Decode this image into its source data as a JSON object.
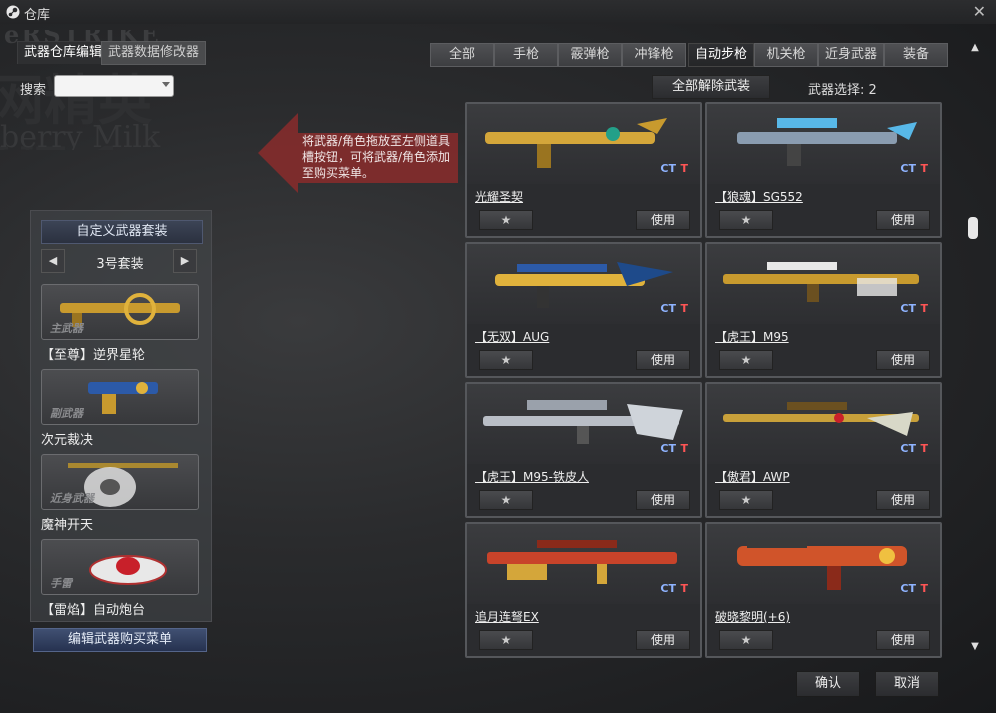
{
  "window": {
    "title": "仓库",
    "close_icon": "close-icon"
  },
  "background_logo": {
    "line1": "eRSTRIKE",
    "line2": "网精英V7.1",
    "line3": "berry Milk Edition"
  },
  "left_tabs": [
    {
      "label": "武器仓库编辑",
      "active": true
    },
    {
      "label": "武器数据修改器",
      "active": false
    }
  ],
  "search": {
    "label": "搜索",
    "value": ""
  },
  "hint": {
    "text": "将武器/角色拖放至左侧道具槽按钮，可将武器/角色添加至购买菜单。"
  },
  "custom_set": {
    "title": "自定义武器套装",
    "set_label": "3号套装",
    "prev_icon": "triangle-left-icon",
    "next_icon": "triangle-right-icon",
    "slots": [
      {
        "type": "主武器",
        "name": "【至尊】逆界星轮"
      },
      {
        "type": "副武器",
        "name": "次元裁决"
      },
      {
        "type": "近身武器",
        "name": "魔神开天"
      },
      {
        "type": "手雷",
        "name": "【雷焰】自动炮台"
      }
    ],
    "edit_buy_label": "编辑武器购买菜单"
  },
  "category_tabs": [
    {
      "label": "全部",
      "active": false
    },
    {
      "label": "手枪",
      "active": false
    },
    {
      "label": "霰弹枪",
      "active": false
    },
    {
      "label": "冲锋枪",
      "active": false
    },
    {
      "label": "自动步枪",
      "active": true
    },
    {
      "label": "机关枪",
      "active": false
    },
    {
      "label": "近身武器",
      "active": false
    },
    {
      "label": "装备",
      "active": false
    }
  ],
  "unequip_all_label": "全部解除武装",
  "weapon_select": {
    "label": "武器选择: 2"
  },
  "team_labels": {
    "ct": "CT",
    "t": "T"
  },
  "card_buttons": {
    "favorite": "★",
    "use": "使用"
  },
  "weapons": [
    {
      "name": "光耀圣契",
      "accent": "#d4a63a"
    },
    {
      "name": "【狼魂】SG552",
      "accent": "#58b8e8"
    },
    {
      "name": "【无双】AUG",
      "accent": "#e0b23c"
    },
    {
      "name": "【虎王】M95",
      "accent": "#c89a2e"
    },
    {
      "name": "【虎王】M95-铁皮人",
      "accent": "#b9bec6"
    },
    {
      "name": "【傲君】AWP",
      "accent": "#c8a03a"
    },
    {
      "name": "追月连弩EX",
      "accent": "#c8432a"
    },
    {
      "name": "破晓黎明(+6)",
      "accent": "#d0542a"
    }
  ],
  "bottom": {
    "confirm": "确认",
    "cancel": "取消"
  },
  "colors": {
    "accent_blue": "#8fb4ff",
    "t_red": "#ff5555",
    "hint_red": "#8a2c2c"
  }
}
